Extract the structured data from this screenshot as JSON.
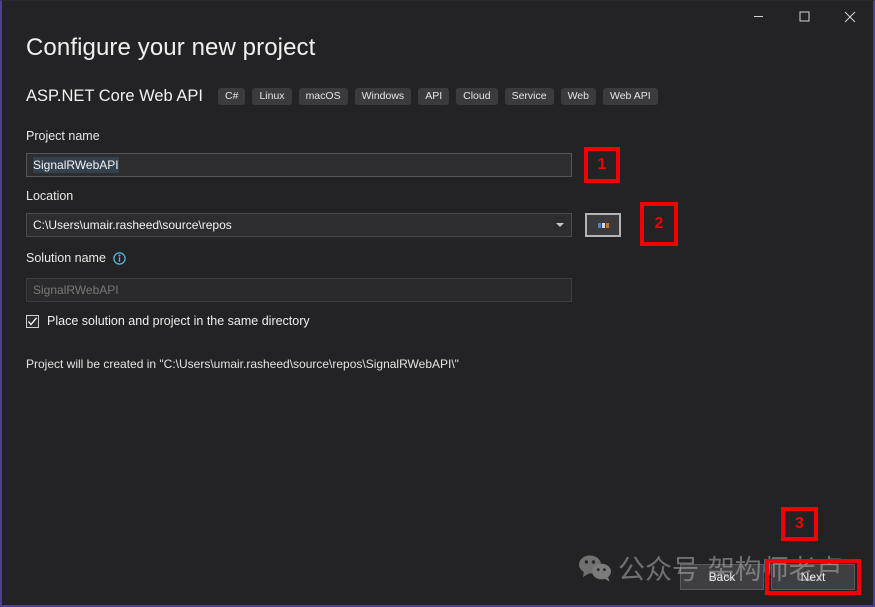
{
  "window": {
    "accent_border_color": "#4b418f",
    "background": "#232325",
    "controls": [
      {
        "name": "minimize",
        "icon": "minimize-icon"
      },
      {
        "name": "maximize",
        "icon": "maximize-icon"
      },
      {
        "name": "close",
        "icon": "close-icon"
      }
    ]
  },
  "header": {
    "title": "Configure your new project",
    "template_name": "ASP.NET Core Web API",
    "tags": [
      "C#",
      "Linux",
      "macOS",
      "Windows",
      "API",
      "Cloud",
      "Service",
      "Web",
      "Web API"
    ]
  },
  "form": {
    "project_name": {
      "label": "Project name",
      "value": "SignalRWebAPI"
    },
    "location": {
      "label": "Location",
      "value": "C:\\Users\\umair.rasheed\\source\\repos",
      "dropdown_icon": "chevron-down-icon",
      "browse_label": "..."
    },
    "solution_name": {
      "label": "Solution name",
      "value": "SignalRWebAPI",
      "info_icon": "info-icon",
      "disabled": true
    },
    "place_solution_checkbox": {
      "label": "Place solution and project in the same directory",
      "checked": true,
      "check_glyph": "✓"
    },
    "creation_note": "Project will be created in \"C:\\Users\\umair.rasheed\\source\\repos\\SignalRWebAPI\\\""
  },
  "footer": {
    "back_label": "Back",
    "next_label": "Next"
  },
  "annotations": {
    "color": "#f40000",
    "badges": [
      {
        "id": "annot-1",
        "label": "1"
      },
      {
        "id": "annot-2",
        "label": "2"
      },
      {
        "id": "annot-3",
        "label": "3"
      }
    ]
  },
  "watermark": {
    "icon": "wechat-icon",
    "text": "公众号  架构师老卢"
  }
}
